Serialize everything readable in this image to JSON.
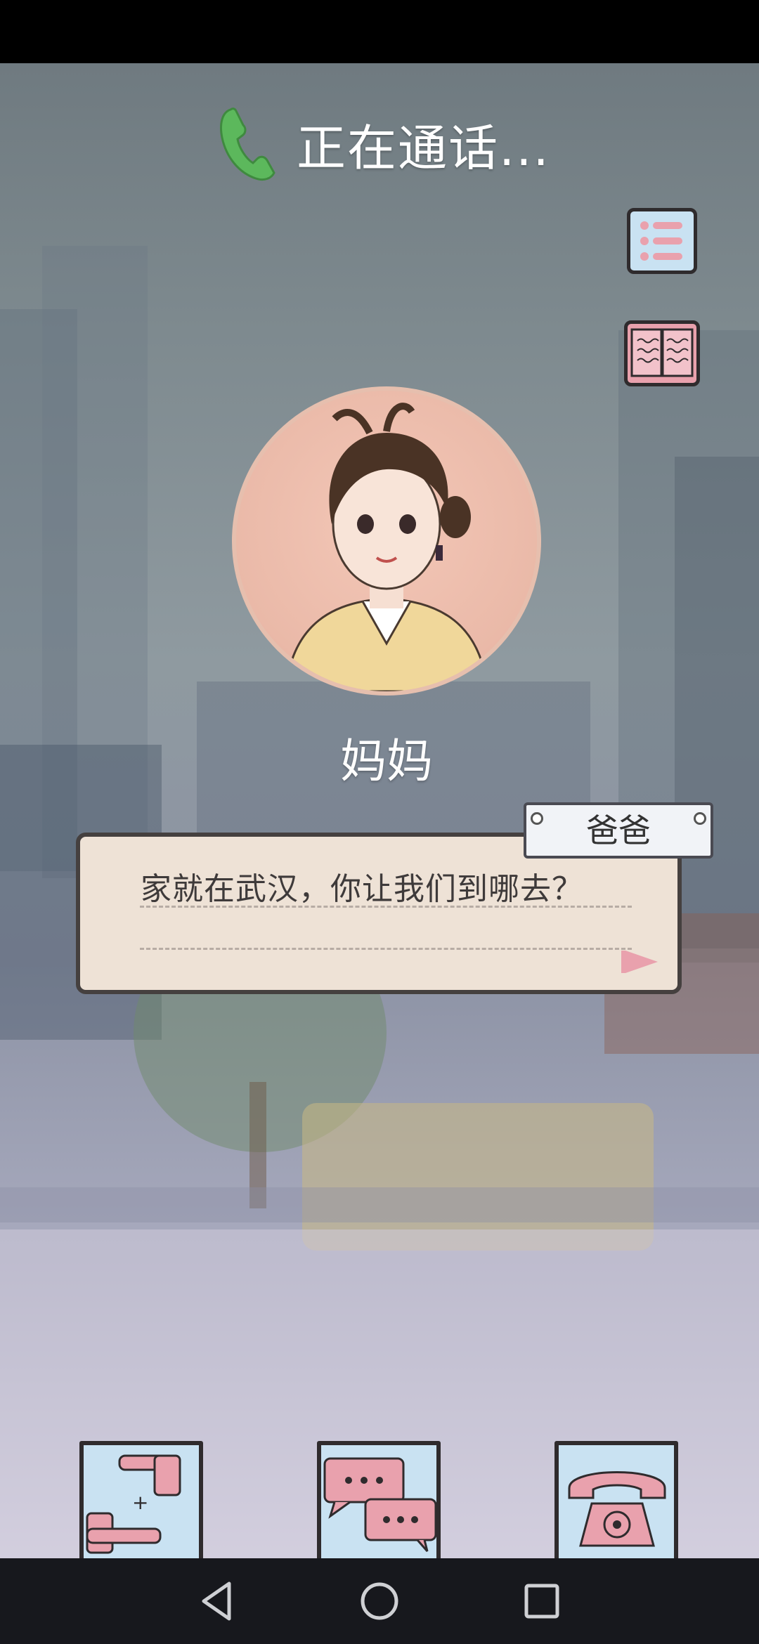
{
  "call": {
    "status": "正在通话..."
  },
  "caller": {
    "name": "妈妈"
  },
  "dialog": {
    "speaker": "爸爸",
    "text": "家就在武汉，你让我们到哪去？"
  },
  "icons": {
    "call": "phone-icon",
    "menu": "list-menu-icon",
    "journal": "book-icon",
    "gesture": "hands-gesture-icon",
    "chat": "chat-bubbles-icon",
    "hangup": "telephone-icon",
    "nav_back": "back-triangle-icon",
    "nav_home": "home-circle-icon",
    "nav_recent": "recent-square-icon"
  },
  "colors": {
    "accent_pink": "#e9a1ad",
    "button_blue": "#c9e2f2",
    "call_green": "#5cb85c"
  }
}
